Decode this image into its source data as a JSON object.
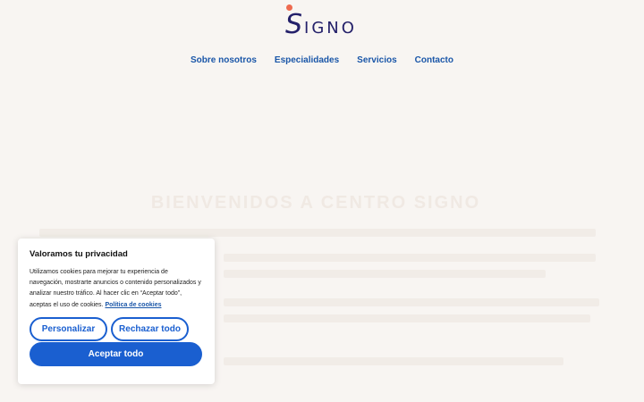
{
  "brand": {
    "logo_initial": "S",
    "logo_rest": "IGNO"
  },
  "nav": {
    "items": [
      {
        "label": "Sobre nosotros"
      },
      {
        "label": "Especialidades"
      },
      {
        "label": "Servicios"
      },
      {
        "label": "Contacto"
      }
    ]
  },
  "hero": {
    "title": "BIENVENIDOS A CENTRO SIGNO"
  },
  "cookie_banner": {
    "title": "Valoramos tu privacidad",
    "body": "Utilizamos cookies para mejorar tu experiencia de navegación, mostrarte anuncios o contenido personalizados y analizar nuestro tráfico. Al hacer clic en “Aceptar todo”, aceptas el uso de cookies.",
    "policy_link": "Política de cookies",
    "customize_label": "Personalizar",
    "reject_label": "Rechazar todo",
    "accept_label": "Aceptar todo"
  },
  "colors": {
    "background": "#f8f5f2",
    "brand_navy": "#24206a",
    "brand_dot": "#ee6a4f",
    "nav_link": "#1a56a8",
    "button_blue": "#1a5fd0"
  }
}
